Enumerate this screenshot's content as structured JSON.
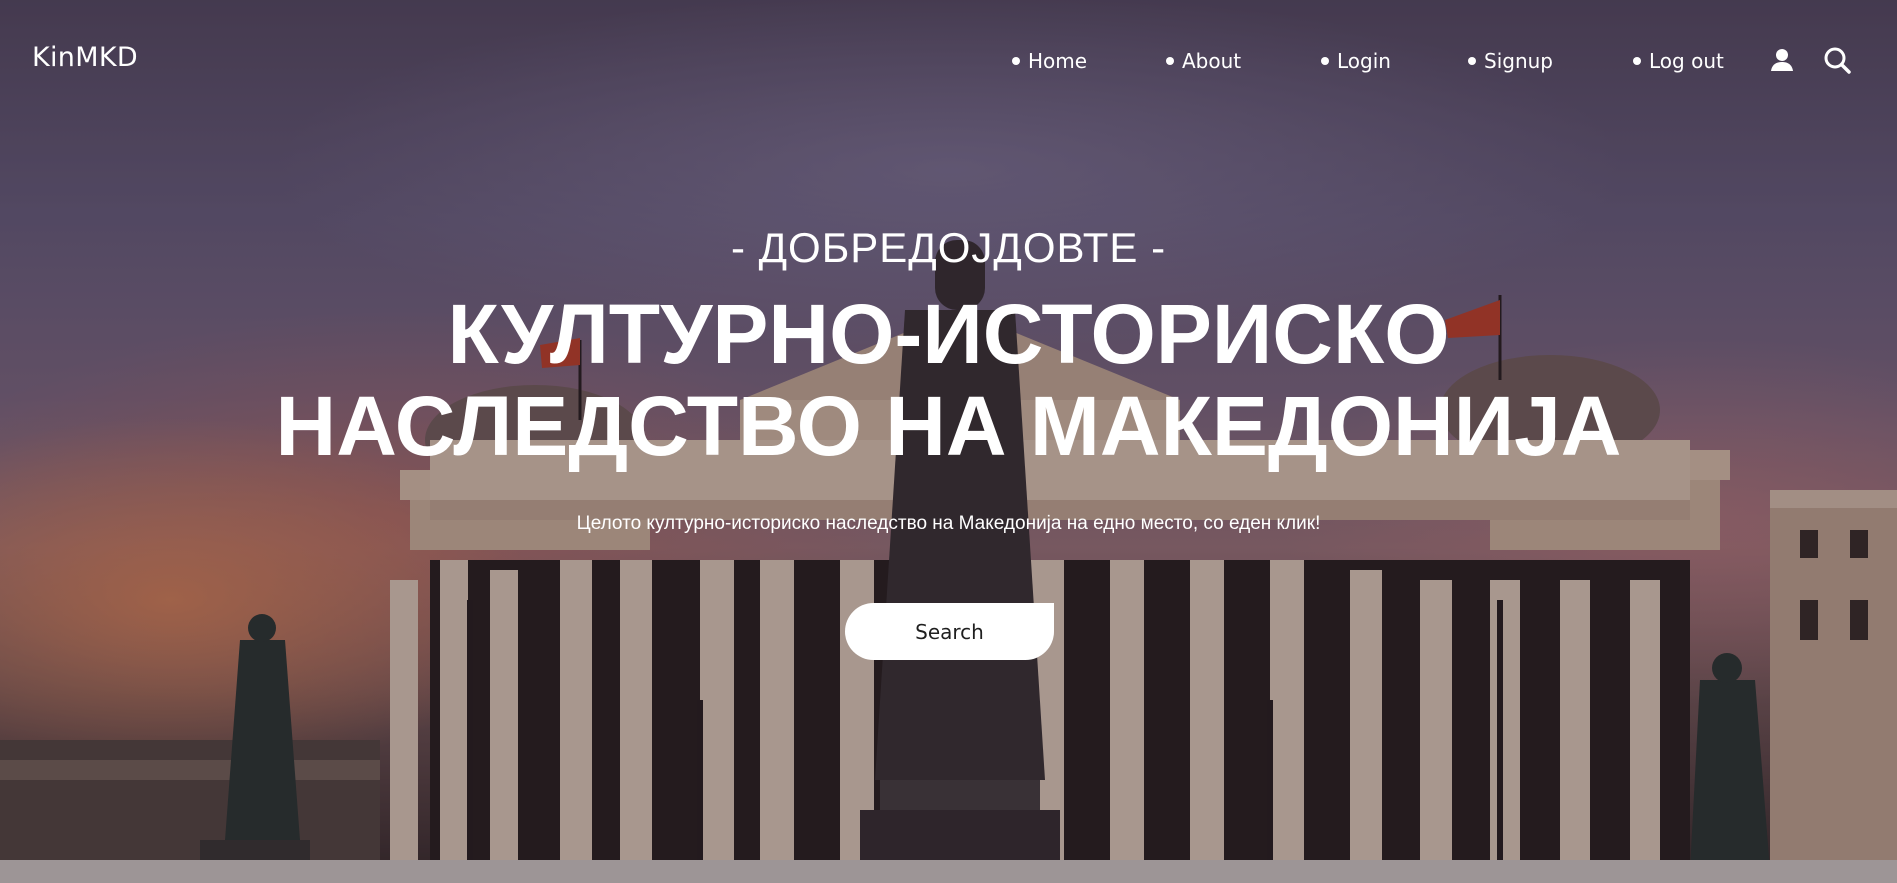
{
  "brand": {
    "name": "KinMKD"
  },
  "nav": {
    "items": [
      {
        "label": "Home"
      },
      {
        "label": "About"
      },
      {
        "label": "Login"
      },
      {
        "label": "Signup"
      },
      {
        "label": "Log out"
      }
    ],
    "icons": [
      "user-icon",
      "search-icon"
    ]
  },
  "hero": {
    "kicker": "- ДОБРЕДОЈДОВТЕ -",
    "headline_line1": "КУЛТУРНО-ИСТОРИСКО",
    "headline_line2": "НАСЛЕДСТВО НА МАКЕДОНИЈА",
    "subtitle": "Целото културно-историско наследство на Македонија на едно место, со еден клик!",
    "button_label": "Search"
  },
  "colors": {
    "text": "#ffffff",
    "button_bg": "#ffffff",
    "button_text": "#1f1f1f"
  }
}
